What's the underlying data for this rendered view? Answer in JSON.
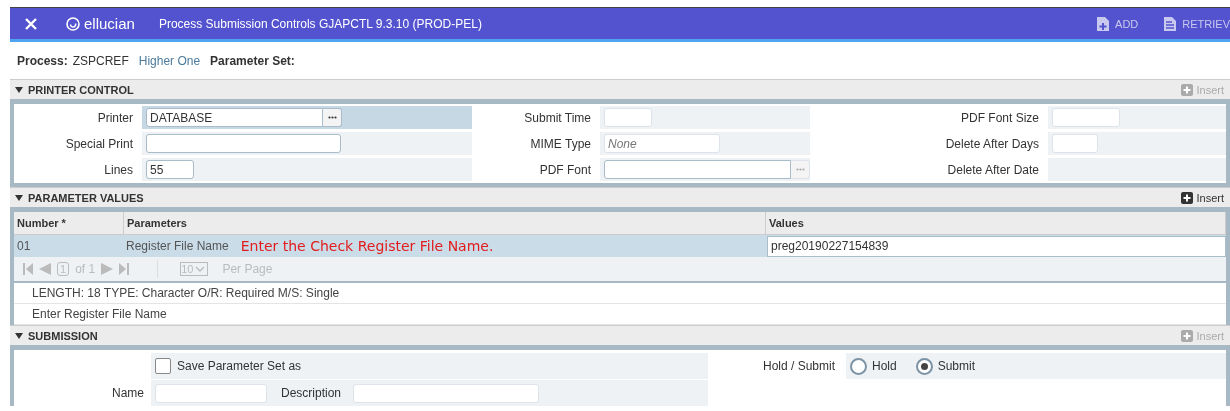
{
  "header": {
    "brand": "ellucian",
    "title": "Process Submission Controls GJAPCTL 9.3.10 (PROD-PEL)",
    "actions": [
      {
        "label": "ADD",
        "kind": "add"
      },
      {
        "label": "RETRIEV",
        "kind": "retrieve"
      }
    ]
  },
  "process": {
    "label": "Process:",
    "code": "ZSPCREF",
    "description": "Higher One",
    "set_label": "Parameter Set:"
  },
  "printer_control": {
    "title": "PRINTER CONTROL",
    "insert": {
      "label": "Insert",
      "disabled": true
    },
    "columns": [
      [
        {
          "label": "Printer",
          "kind": "lookup",
          "value": "DATABASE",
          "focused": true
        },
        {
          "label": "Special Print",
          "kind": "text",
          "focused": false
        },
        {
          "label": "Lines",
          "kind": "text",
          "value": "55",
          "focused": false
        }
      ],
      [
        {
          "label": "Submit Time",
          "kind": "text",
          "focused": false
        },
        {
          "label": "MIME Type",
          "kind": "text",
          "placeholder": "None",
          "focused": false
        },
        {
          "label": "PDF Font",
          "kind": "lookup",
          "focused": false
        }
      ],
      [
        {
          "label": "PDF Font Size",
          "kind": "text",
          "focused": false
        },
        {
          "label": "Delete After Days",
          "kind": "text",
          "focused": false
        },
        {
          "label": "Delete After Date",
          "kind": "empty",
          "focused": false
        }
      ]
    ]
  },
  "parameter_values": {
    "title": "PARAMETER VALUES",
    "insert": {
      "label": "Insert",
      "disabled": false
    },
    "columns": [
      "Number *",
      "Parameters",
      "Values"
    ],
    "rows": [
      {
        "number": "01",
        "parameter": "Register File Name",
        "annotation": "Enter the Check Register File Name.",
        "value": "preg20190227154839",
        "selected": true
      }
    ],
    "pager": {
      "page": "1",
      "of": "of 1",
      "per_page": "10",
      "per_page_label": "Per Page"
    },
    "info": [
      "LENGTH: 18 TYPE: Character O/R: Required M/S: Single",
      "Enter Register File Name"
    ]
  },
  "submission": {
    "title": "SUBMISSION",
    "insert": {
      "label": "Insert",
      "disabled": true
    },
    "save_set": {
      "label": "Save Parameter Set as",
      "checked": false
    },
    "name_label": "Name",
    "description_label": "Description",
    "hold_submit": {
      "label": "Hold / Submit",
      "options": [
        {
          "label": "Hold",
          "selected": false
        },
        {
          "label": "Submit",
          "selected": true
        }
      ]
    }
  }
}
